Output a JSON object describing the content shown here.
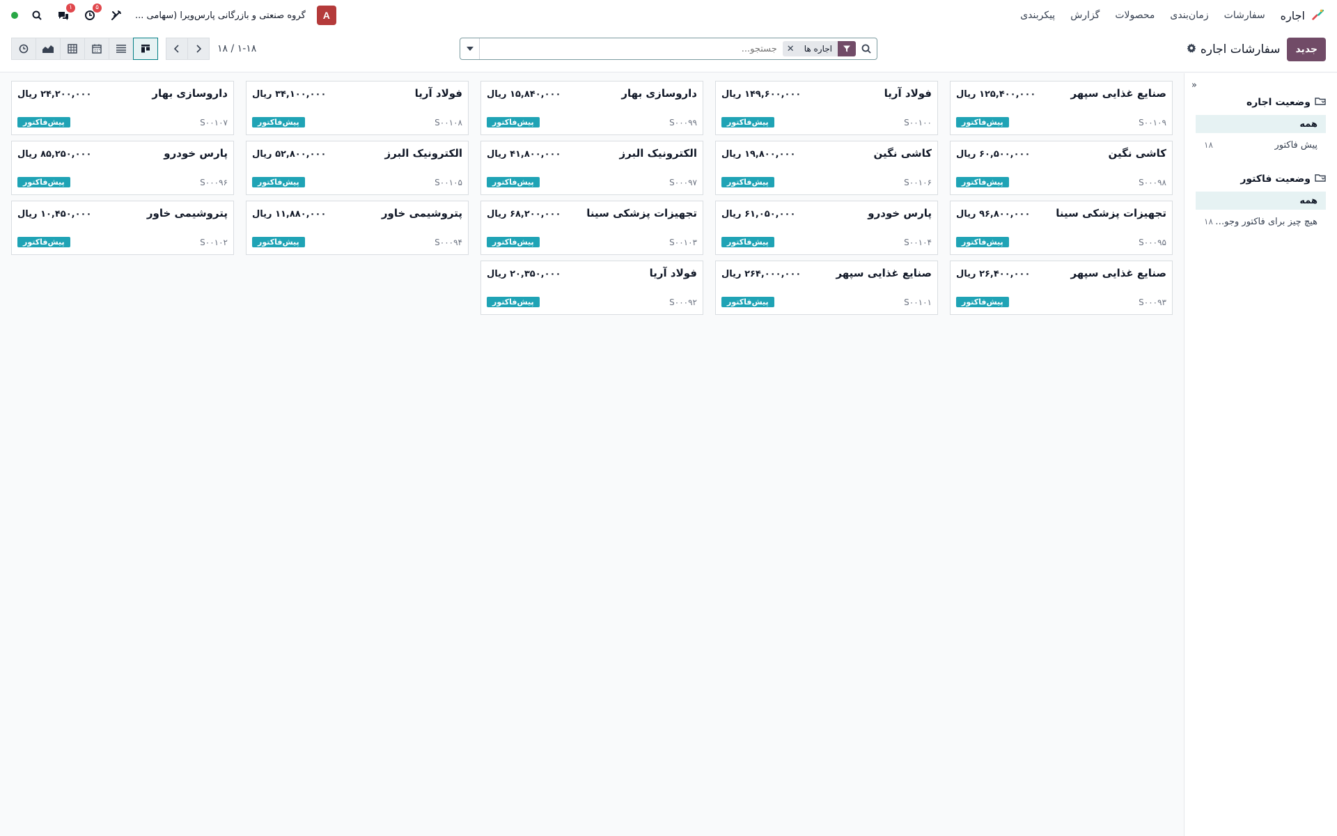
{
  "app": {
    "name": "اجاره"
  },
  "menu": {
    "items": [
      "سفارشات",
      "زمان‌بندی",
      "محصولات",
      "گزارش",
      "پیکربندی"
    ]
  },
  "topbar": {
    "company": "گروه صنعتی و بازرگانی پارس‌ویرا (سهامی ...",
    "avatar": "A",
    "activity_badge": "۵",
    "chat_badge": "۱"
  },
  "control": {
    "new_label": "جدید",
    "title": "سفارشات اجاره",
    "pager": "۱-۱۸ / ۱۸"
  },
  "search": {
    "facet": "اجاره ها",
    "placeholder": "جستجو..."
  },
  "sidebar": {
    "sections": [
      {
        "title": "وضعیت اجاره",
        "items": [
          {
            "label": "همه",
            "count": ""
          },
          {
            "label": "پیش فاکتور",
            "count": "۱۸"
          }
        ]
      },
      {
        "title": "وضعیت فاکتور",
        "items": [
          {
            "label": "همه",
            "count": ""
          },
          {
            "label": "هیچ چیز برای فاکتور وجود ندارد",
            "count": "۱۸"
          }
        ]
      }
    ]
  },
  "cards": [
    {
      "customer": "صنایع غذایی سپهر",
      "amount": "۱۲۵,۴۰۰,۰۰۰ ریال",
      "ref": "S۰۰۱۰۹",
      "status": "پیش‌فاکتور"
    },
    {
      "customer": "فولاد آریا",
      "amount": "۱۴۹,۶۰۰,۰۰۰ ریال",
      "ref": "S۰۰۱۰۰",
      "status": "پیش‌فاکتور"
    },
    {
      "customer": "داروسازی بهار",
      "amount": "۱۵,۸۴۰,۰۰۰ ریال",
      "ref": "S۰۰۰۹۹",
      "status": "پیش‌فاکتور"
    },
    {
      "customer": "فولاد آریا",
      "amount": "۳۴,۱۰۰,۰۰۰ ریال",
      "ref": "S۰۰۱۰۸",
      "status": "پیش‌فاکتور"
    },
    {
      "customer": "داروسازی بهار",
      "amount": "۲۴,۲۰۰,۰۰۰ ریال",
      "ref": "S۰۰۱۰۷",
      "status": "پیش‌فاکتور"
    },
    {
      "customer": "کاشی نگین",
      "amount": "۶۰,۵۰۰,۰۰۰ ریال",
      "ref": "S۰۰۰۹۸",
      "status": "پیش‌فاکتور"
    },
    {
      "customer": "کاشی نگین",
      "amount": "۱۹,۸۰۰,۰۰۰ ریال",
      "ref": "S۰۰۱۰۶",
      "status": "پیش‌فاکتور"
    },
    {
      "customer": "الکترونیک البرز",
      "amount": "۴۱,۸۰۰,۰۰۰ ریال",
      "ref": "S۰۰۰۹۷",
      "status": "پیش‌فاکتور"
    },
    {
      "customer": "الکترونیک البرز",
      "amount": "۵۲,۸۰۰,۰۰۰ ریال",
      "ref": "S۰۰۱۰۵",
      "status": "پیش‌فاکتور"
    },
    {
      "customer": "پارس خودرو",
      "amount": "۸۵,۲۵۰,۰۰۰ ریال",
      "ref": "S۰۰۰۹۶",
      "status": "پیش‌فاکتور"
    },
    {
      "customer": "تجهیزات پزشکی سینا",
      "amount": "۹۶,۸۰۰,۰۰۰ ریال",
      "ref": "S۰۰۰۹۵",
      "status": "پیش‌فاکتور"
    },
    {
      "customer": "پارس خودرو",
      "amount": "۶۱,۰۵۰,۰۰۰ ریال",
      "ref": "S۰۰۱۰۴",
      "status": "پیش‌فاکتور"
    },
    {
      "customer": "تجهیزات پزشکی سینا",
      "amount": "۶۸,۲۰۰,۰۰۰ ریال",
      "ref": "S۰۰۱۰۳",
      "status": "پیش‌فاکتور"
    },
    {
      "customer": "پتروشیمی خاور",
      "amount": "۱۱,۸۸۰,۰۰۰ ریال",
      "ref": "S۰۰۰۹۴",
      "status": "پیش‌فاکتور"
    },
    {
      "customer": "پتروشیمی خاور",
      "amount": "۱۰,۴۵۰,۰۰۰ ریال",
      "ref": "S۰۰۱۰۲",
      "status": "پیش‌فاکتور"
    },
    {
      "customer": "صنایع غذایی سپهر",
      "amount": "۲۶,۴۰۰,۰۰۰ ریال",
      "ref": "S۰۰۰۹۳",
      "status": "پیش‌فاکتور"
    },
    {
      "customer": "صنایع غذایی سپهر",
      "amount": "۲۶۴,۰۰۰,۰۰۰ ریال",
      "ref": "S۰۰۱۰۱",
      "status": "پیش‌فاکتور"
    },
    {
      "customer": "فولاد آریا",
      "amount": "۲۰,۳۵۰,۰۰۰ ریال",
      "ref": "S۰۰۰۹۲",
      "status": "پیش‌فاکتور"
    }
  ],
  "colors": {
    "brand": "#714b67",
    "teal": "#017e84",
    "status_badge": "#1fa3b5",
    "avatar": "#b43a3a"
  },
  "icons": [
    "rental-logo-icon",
    "bug-icon",
    "clock-icon",
    "chat-icon",
    "search-icon",
    "filter-icon",
    "caret-down-icon",
    "gear-icon",
    "kanban-icon",
    "list-icon",
    "calendar-icon",
    "pivot-icon",
    "graph-icon",
    "activity-icon",
    "chevron-left-icon",
    "chevron-right-icon",
    "collapse-icon",
    "folder-icon"
  ]
}
